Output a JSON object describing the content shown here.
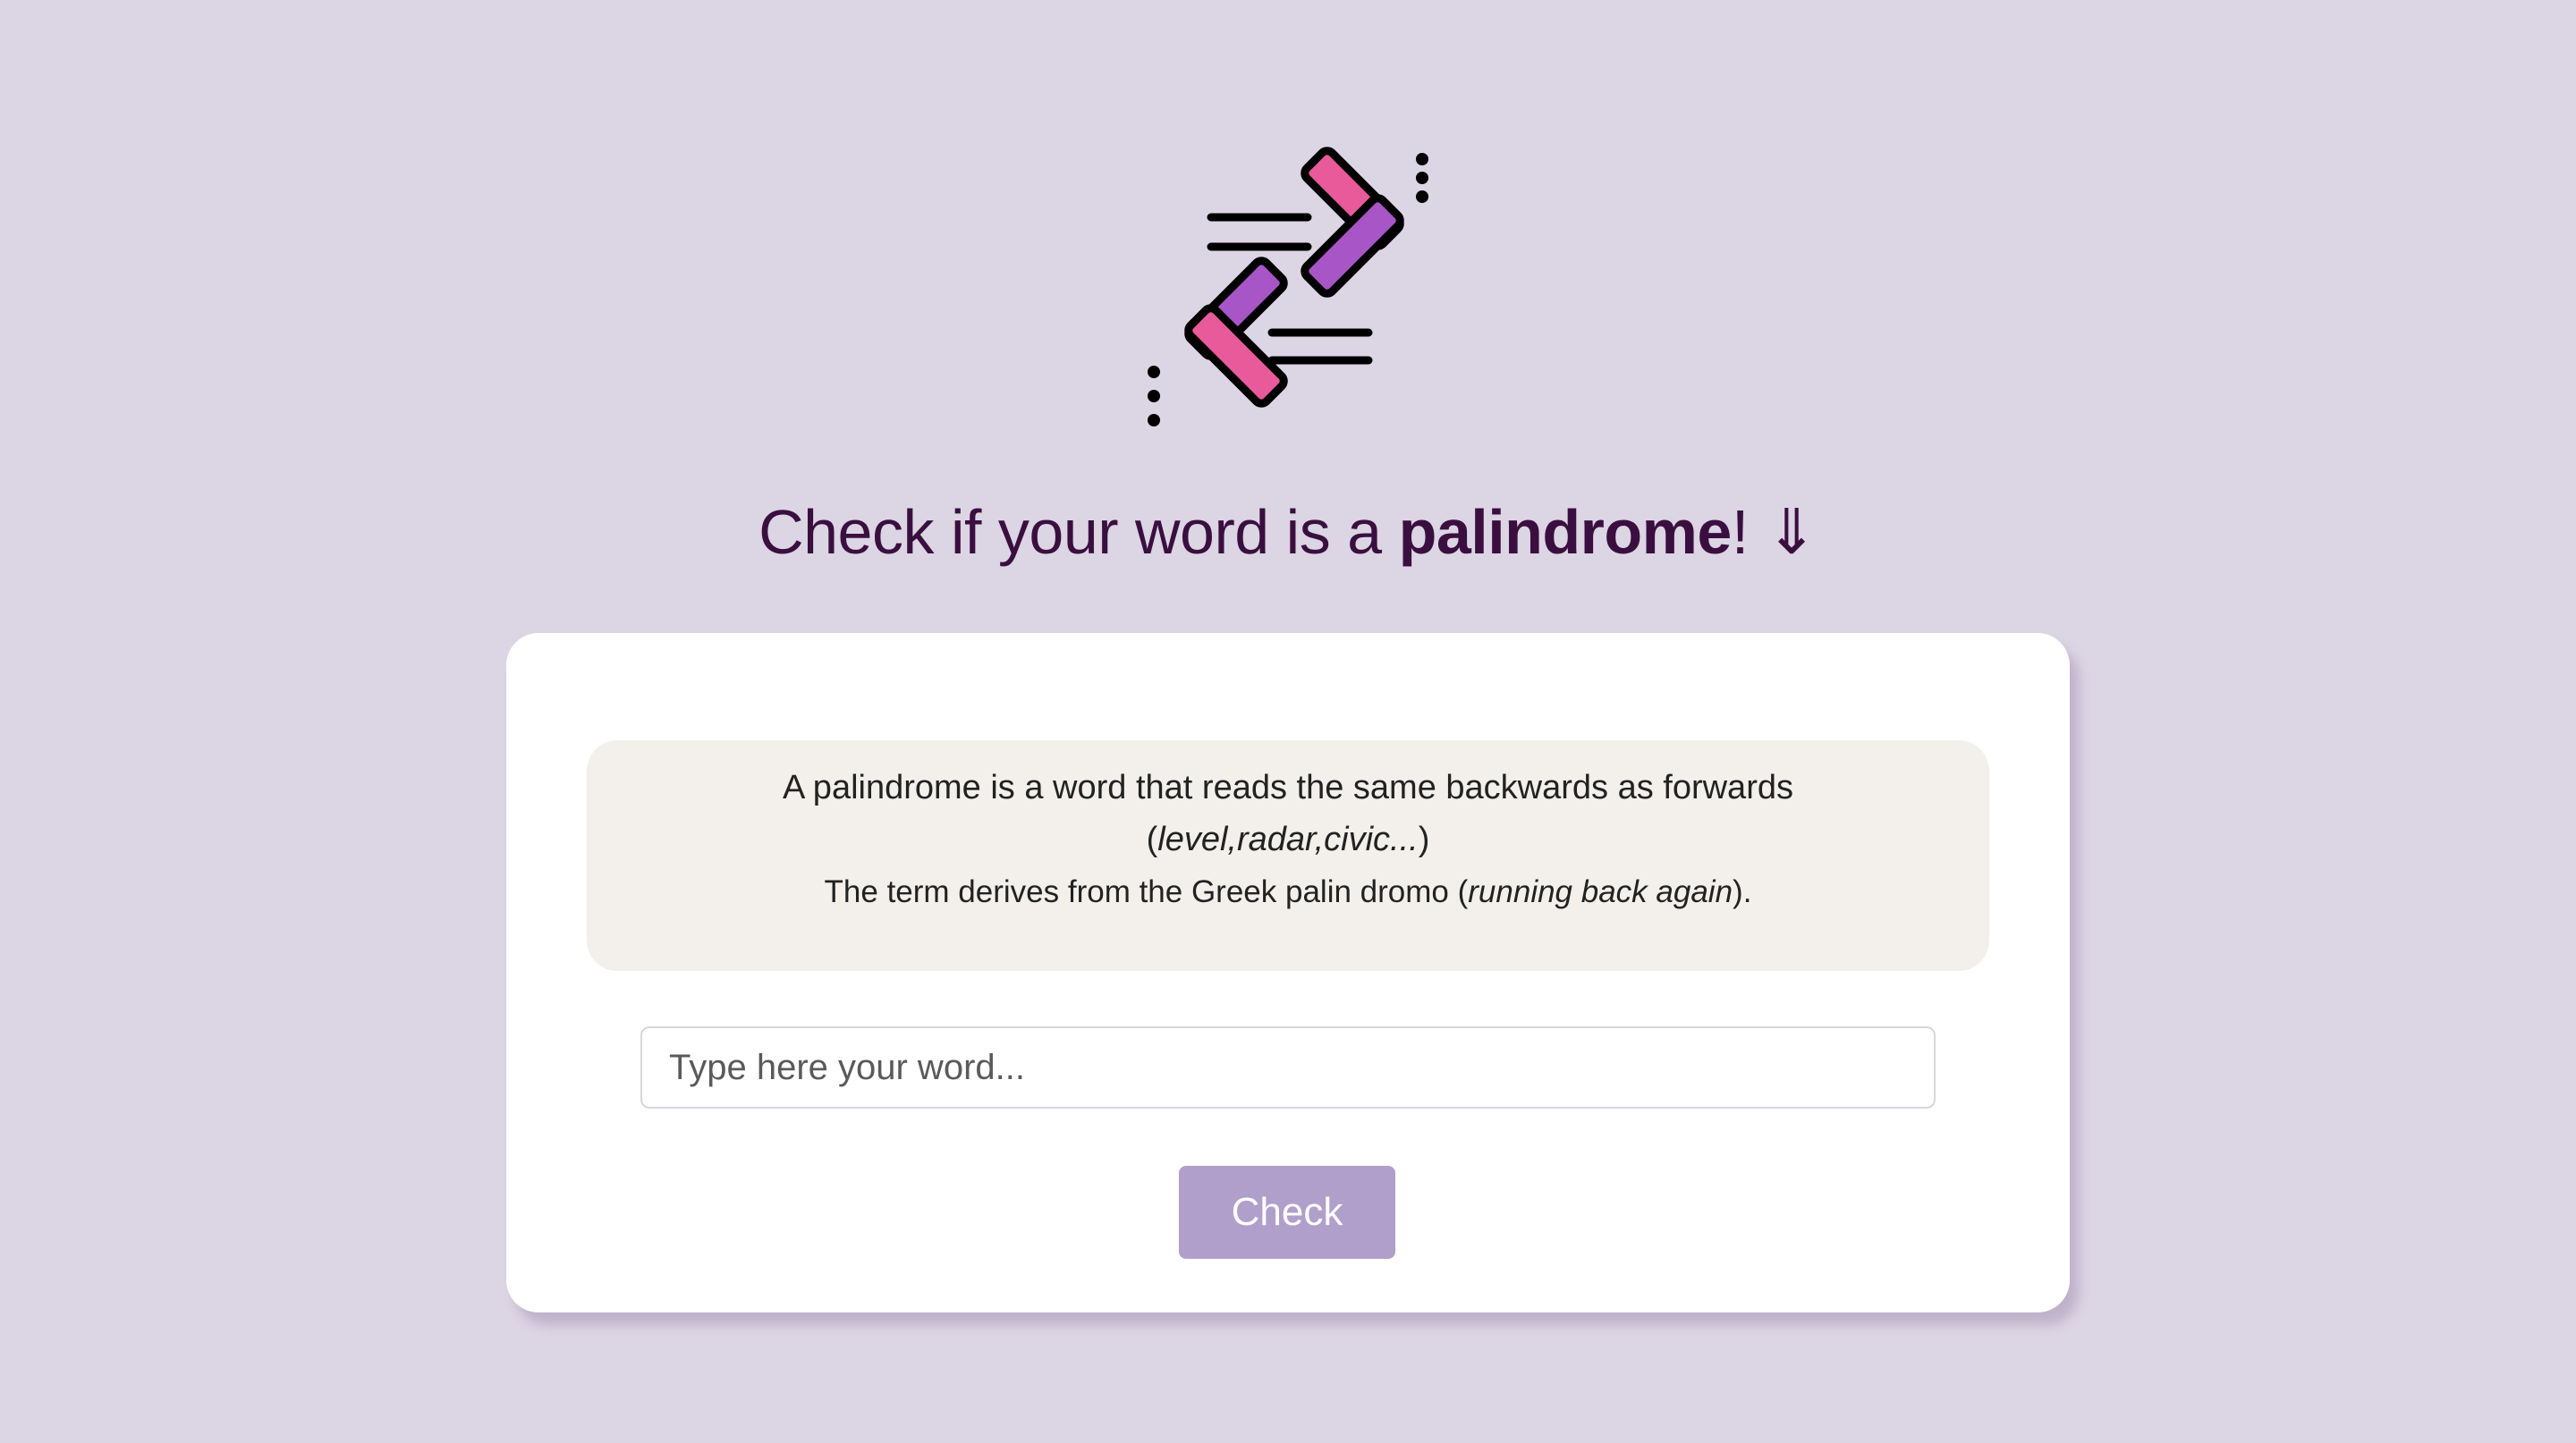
{
  "header": {
    "title_prefix": "Check if your word is a ",
    "title_bold": "palindrome",
    "title_suffix": "!",
    "title_arrow": "⇓"
  },
  "info": {
    "definition": "A palindrome is a word that reads the same backwards as forwards",
    "examples_open": "(",
    "examples": "level,radar,civic...",
    "examples_close": ")",
    "etymology_prefix": "The term derives from the Greek palin dromo (",
    "etymology_italic": "running back again",
    "etymology_suffix": ")."
  },
  "form": {
    "input_placeholder": "Type here your word...",
    "input_value": "",
    "button_label": "Check"
  },
  "colors": {
    "background": "#dcd5e3",
    "heading": "#3a0f40",
    "button": "#b19fcb",
    "icon_pink": "#e85a9a",
    "icon_purple": "#a855c7"
  },
  "icons": {
    "logo": "palindrome-arrows-icon"
  }
}
